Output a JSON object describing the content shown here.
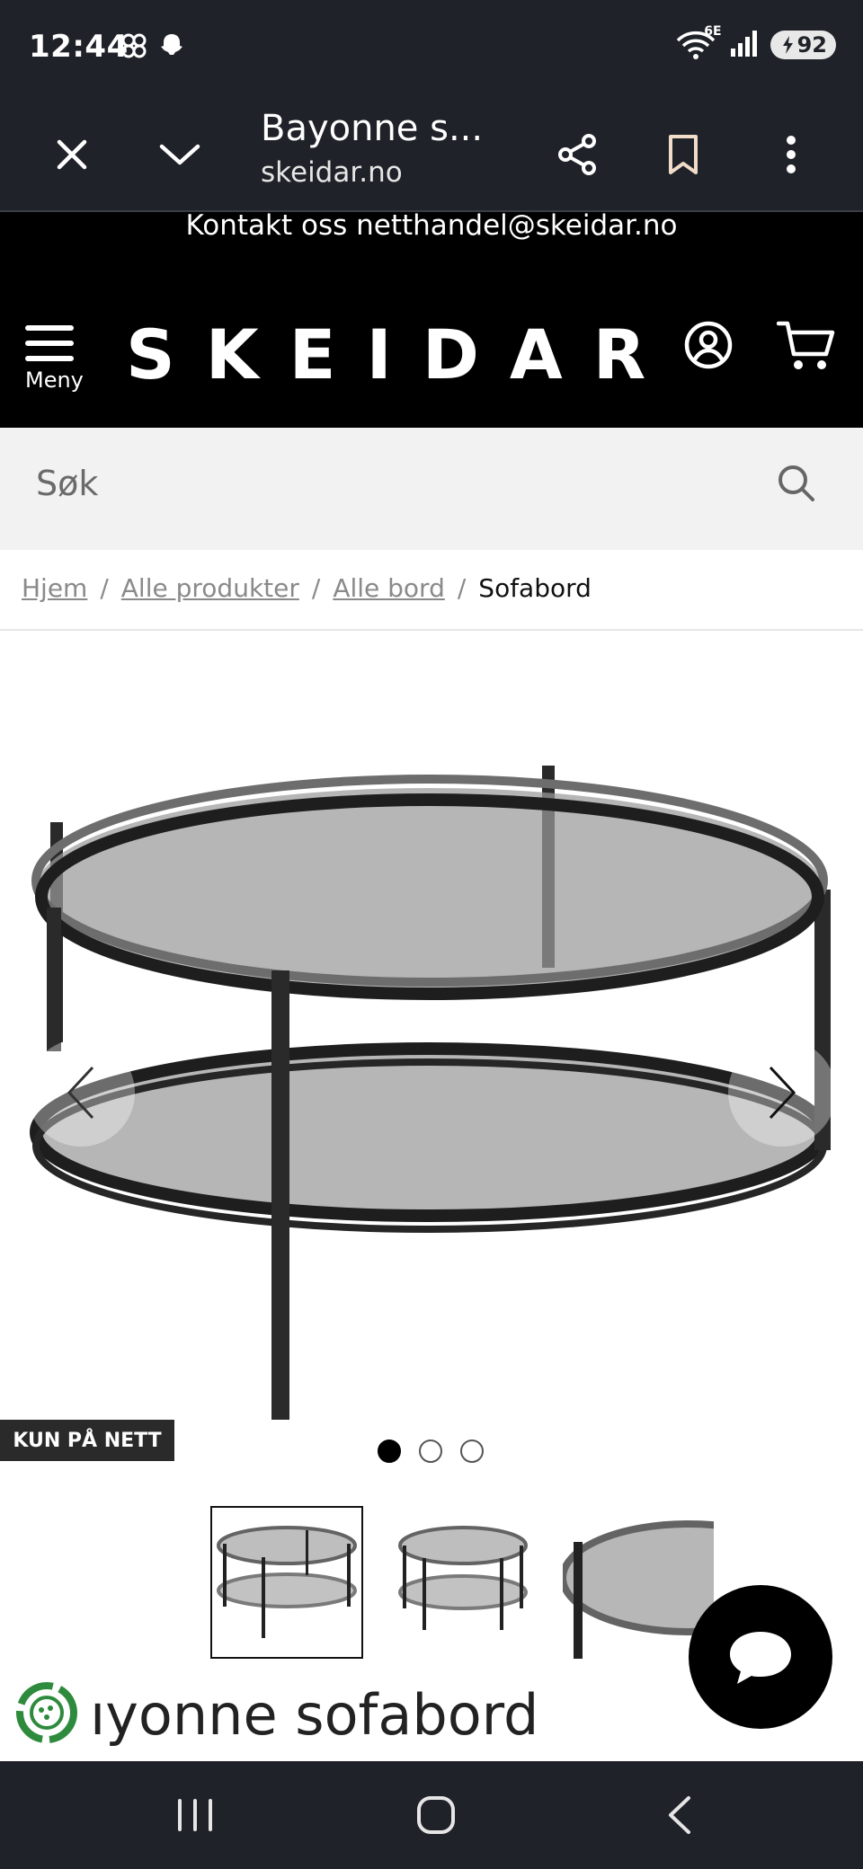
{
  "status_bar": {
    "time": "12:44",
    "network_label": "6E",
    "battery": "92",
    "icons": [
      "pinwheel-icon",
      "snapchat-icon",
      "wifi-icon",
      "signal-icon",
      "battery-icon"
    ]
  },
  "browser": {
    "page_title": "Bayonne s...",
    "domain": "skeidar.no",
    "icons": [
      "close-icon",
      "chevron-down-icon",
      "share-icon",
      "bookmark-icon",
      "more-vert-icon"
    ]
  },
  "site": {
    "contact_text": "Kontakt oss netthandel@skeidar.no",
    "menu_label": "Meny",
    "logo_text": "SKEIDAR"
  },
  "search": {
    "placeholder": "Søk"
  },
  "breadcrumb": {
    "items": [
      "Hjem",
      "Alle produkter",
      "Alle bord"
    ],
    "separator": "/",
    "current": "Sofabord"
  },
  "product": {
    "badge": "KUN PÅ NETT",
    "title": "Bayonne sofabord",
    "visible_title": "ıyonne sofabord",
    "image_count": 3,
    "active_image": 1
  },
  "colors": {
    "system_bar": "#1f2228",
    "header_bg": "#000000",
    "search_bg": "#f2f2f2",
    "accent_green": "#2e8b3d"
  }
}
